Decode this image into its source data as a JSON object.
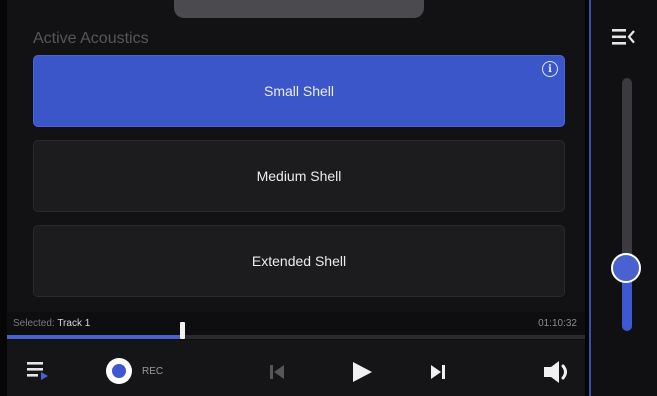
{
  "header": {
    "section_title": "Active Acoustics"
  },
  "presets": [
    {
      "label": "Small Shell",
      "active": true,
      "has_info": true
    },
    {
      "label": "Medium Shell",
      "active": false
    },
    {
      "label": "Extended Shell",
      "active": false
    }
  ],
  "info_glyph": "i",
  "track": {
    "selected_prefix": "Selected:",
    "track_name": "Track 1",
    "time": "01:10:32",
    "progress": 0.3
  },
  "transport": {
    "rec_label": "REC",
    "icons": [
      "playlist-icon",
      "skip-back-icon",
      "play-icon",
      "skip-forward-icon",
      "volume-icon"
    ]
  },
  "side": {
    "menu_icon": "collapse-menu-icon",
    "volume_level": 0.12
  },
  "colors": {
    "accent": "#3b56c9",
    "background": "#121214",
    "button": "#1c1c1f"
  }
}
